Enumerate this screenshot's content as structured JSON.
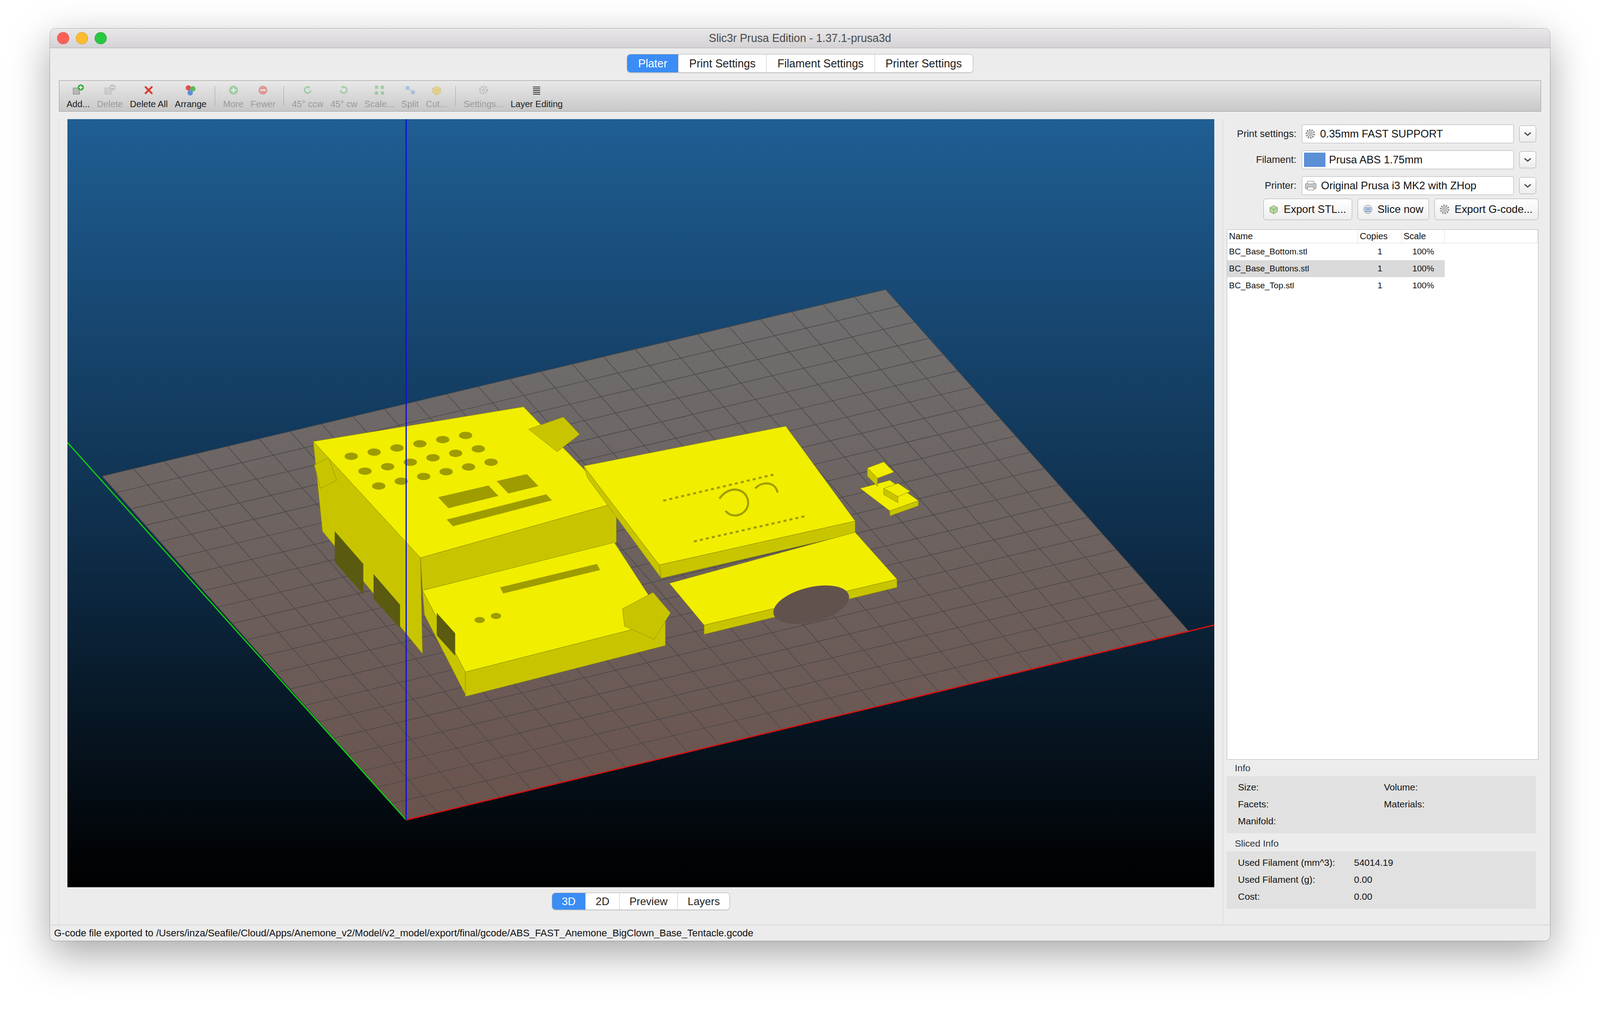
{
  "window": {
    "title": "Slic3r Prusa Edition - 1.37.1-prusa3d"
  },
  "tabs": [
    {
      "label": "Plater",
      "selected": true
    },
    {
      "label": "Print Settings",
      "selected": false
    },
    {
      "label": "Filament Settings",
      "selected": false
    },
    {
      "label": "Printer Settings",
      "selected": false
    }
  ],
  "toolbar": {
    "groups": [
      [
        {
          "label": "Add...",
          "disabled": false
        },
        {
          "label": "Delete",
          "disabled": true
        },
        {
          "label": "Delete All",
          "disabled": false
        },
        {
          "label": "Arrange",
          "disabled": false
        }
      ],
      [
        {
          "label": "More",
          "disabled": true
        },
        {
          "label": "Fewer",
          "disabled": true
        }
      ],
      [
        {
          "label": "45° ccw",
          "disabled": true
        },
        {
          "label": "45° cw",
          "disabled": true
        },
        {
          "label": "Scale...",
          "disabled": true
        },
        {
          "label": "Split",
          "disabled": true
        },
        {
          "label": "Cut...",
          "disabled": true
        }
      ],
      [
        {
          "label": "Settings...",
          "disabled": true
        },
        {
          "label": "Layer Editing",
          "disabled": false
        }
      ]
    ]
  },
  "presets": [
    {
      "label": "Print settings:",
      "value": "0.35mm FAST SUPPORT"
    },
    {
      "label": "Filament:",
      "value": "Prusa ABS 1.75mm",
      "color": "#5b8fd6"
    },
    {
      "label": "Printer:",
      "value": "Original Prusa i3 MK2 with ZHop"
    }
  ],
  "actions": [
    "Export STL...",
    "Slice now",
    "Export G-code..."
  ],
  "objects": {
    "columns": [
      "Name",
      "Copies",
      "Scale"
    ],
    "rows": [
      {
        "name": "BC_Base_Bottom.stl",
        "copies": "1",
        "scale": "100%",
        "selected": false
      },
      {
        "name": "BC_Base_Buttons.stl",
        "copies": "1",
        "scale": "100%",
        "selected": true
      },
      {
        "name": "BC_Base_Top.stl",
        "copies": "1",
        "scale": "100%",
        "selected": false
      }
    ]
  },
  "info": {
    "title": "Info",
    "left": [
      "Size:",
      "Facets:",
      "Manifold:"
    ],
    "right": [
      "Volume:",
      "Materials:"
    ]
  },
  "sliced_info": {
    "title": "Sliced Info",
    "rows": [
      {
        "label": "Used Filament (mm^3):",
        "value": "54014.19"
      },
      {
        "label": "Used Filament (g):",
        "value": "0.00"
      },
      {
        "label": "Cost:",
        "value": "0.00"
      }
    ]
  },
  "view_tabs": [
    {
      "label": "3D",
      "selected": true
    },
    {
      "label": "2D",
      "selected": false
    },
    {
      "label": "Preview",
      "selected": false
    },
    {
      "label": "Layers",
      "selected": false
    }
  ],
  "status_bar": "G-code file exported to /Users/inza/Seafile/Cloud/Apps/Anemone_v2/Model/v2_model/export/final/gcode/ABS_FAST_Anemone_BigClown_Base_Tentacle.gcode"
}
